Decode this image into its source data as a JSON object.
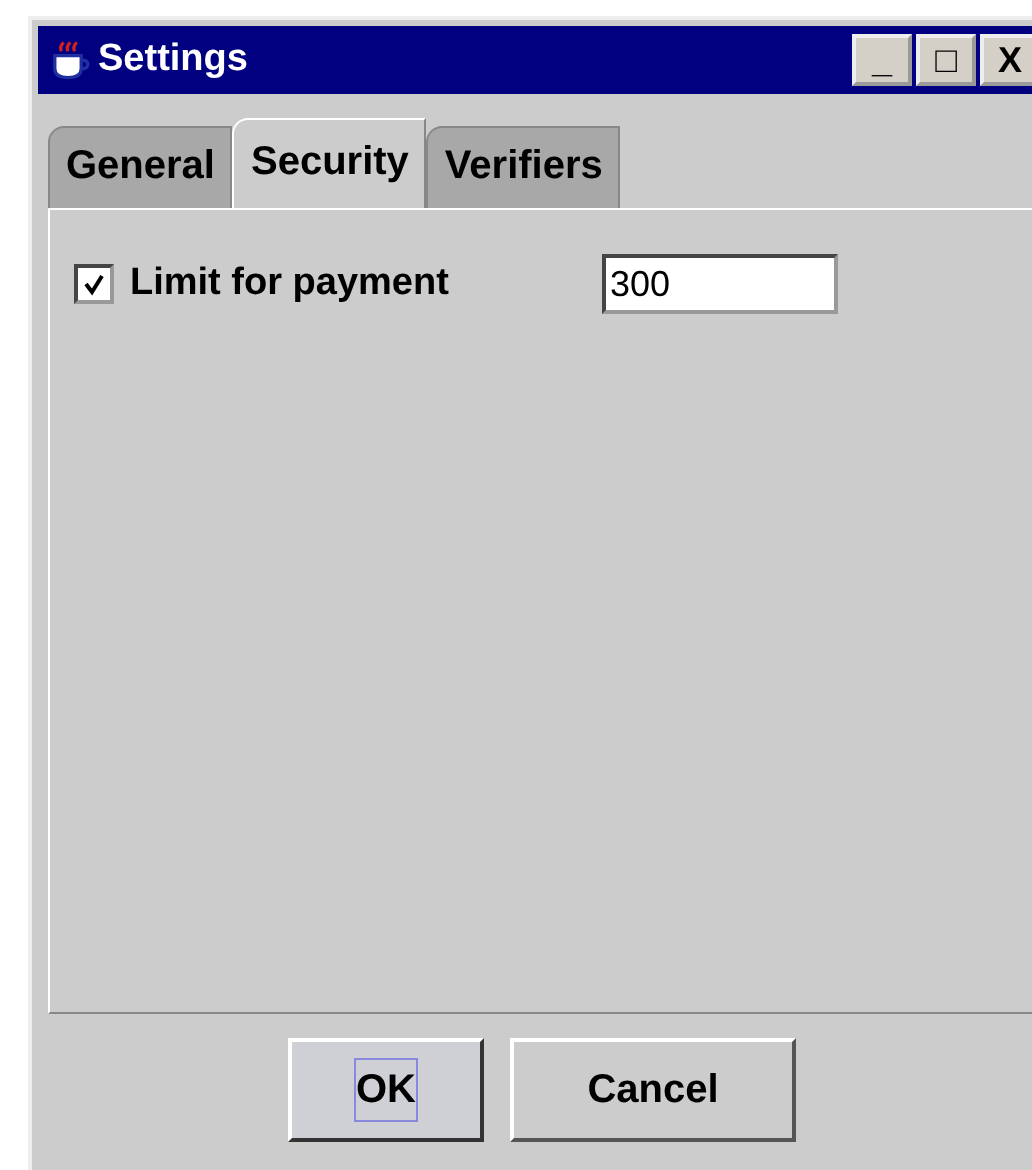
{
  "window": {
    "title": "Settings",
    "controls": [
      "_",
      "□",
      "X"
    ]
  },
  "tabs": [
    {
      "label": "General",
      "selected": false
    },
    {
      "label": "Security",
      "selected": true
    },
    {
      "label": "Verifiers",
      "selected": false
    }
  ],
  "limit": {
    "label": "Limit for payment",
    "checked": true,
    "value": "300"
  },
  "buttons": [
    {
      "label": "OK",
      "focused": true
    },
    {
      "label": "Cancel",
      "focused": false
    }
  ]
}
